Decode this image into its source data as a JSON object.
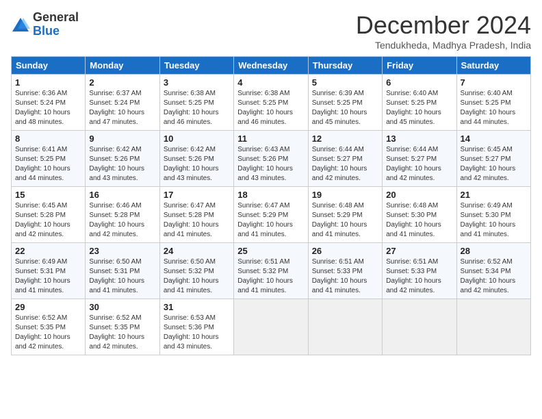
{
  "header": {
    "logo_general": "General",
    "logo_blue": "Blue",
    "title": "December 2024",
    "location": "Tendukheda, Madhya Pradesh, India"
  },
  "weekdays": [
    "Sunday",
    "Monday",
    "Tuesday",
    "Wednesday",
    "Thursday",
    "Friday",
    "Saturday"
  ],
  "weeks": [
    [
      {
        "day": "1",
        "info": "Sunrise: 6:36 AM\nSunset: 5:24 PM\nDaylight: 10 hours\nand 48 minutes."
      },
      {
        "day": "2",
        "info": "Sunrise: 6:37 AM\nSunset: 5:24 PM\nDaylight: 10 hours\nand 47 minutes."
      },
      {
        "day": "3",
        "info": "Sunrise: 6:38 AM\nSunset: 5:25 PM\nDaylight: 10 hours\nand 46 minutes."
      },
      {
        "day": "4",
        "info": "Sunrise: 6:38 AM\nSunset: 5:25 PM\nDaylight: 10 hours\nand 46 minutes."
      },
      {
        "day": "5",
        "info": "Sunrise: 6:39 AM\nSunset: 5:25 PM\nDaylight: 10 hours\nand 45 minutes."
      },
      {
        "day": "6",
        "info": "Sunrise: 6:40 AM\nSunset: 5:25 PM\nDaylight: 10 hours\nand 45 minutes."
      },
      {
        "day": "7",
        "info": "Sunrise: 6:40 AM\nSunset: 5:25 PM\nDaylight: 10 hours\nand 44 minutes."
      }
    ],
    [
      {
        "day": "8",
        "info": "Sunrise: 6:41 AM\nSunset: 5:25 PM\nDaylight: 10 hours\nand 44 minutes."
      },
      {
        "day": "9",
        "info": "Sunrise: 6:42 AM\nSunset: 5:26 PM\nDaylight: 10 hours\nand 43 minutes."
      },
      {
        "day": "10",
        "info": "Sunrise: 6:42 AM\nSunset: 5:26 PM\nDaylight: 10 hours\nand 43 minutes."
      },
      {
        "day": "11",
        "info": "Sunrise: 6:43 AM\nSunset: 5:26 PM\nDaylight: 10 hours\nand 43 minutes."
      },
      {
        "day": "12",
        "info": "Sunrise: 6:44 AM\nSunset: 5:27 PM\nDaylight: 10 hours\nand 42 minutes."
      },
      {
        "day": "13",
        "info": "Sunrise: 6:44 AM\nSunset: 5:27 PM\nDaylight: 10 hours\nand 42 minutes."
      },
      {
        "day": "14",
        "info": "Sunrise: 6:45 AM\nSunset: 5:27 PM\nDaylight: 10 hours\nand 42 minutes."
      }
    ],
    [
      {
        "day": "15",
        "info": "Sunrise: 6:45 AM\nSunset: 5:28 PM\nDaylight: 10 hours\nand 42 minutes."
      },
      {
        "day": "16",
        "info": "Sunrise: 6:46 AM\nSunset: 5:28 PM\nDaylight: 10 hours\nand 42 minutes."
      },
      {
        "day": "17",
        "info": "Sunrise: 6:47 AM\nSunset: 5:28 PM\nDaylight: 10 hours\nand 41 minutes."
      },
      {
        "day": "18",
        "info": "Sunrise: 6:47 AM\nSunset: 5:29 PM\nDaylight: 10 hours\nand 41 minutes."
      },
      {
        "day": "19",
        "info": "Sunrise: 6:48 AM\nSunset: 5:29 PM\nDaylight: 10 hours\nand 41 minutes."
      },
      {
        "day": "20",
        "info": "Sunrise: 6:48 AM\nSunset: 5:30 PM\nDaylight: 10 hours\nand 41 minutes."
      },
      {
        "day": "21",
        "info": "Sunrise: 6:49 AM\nSunset: 5:30 PM\nDaylight: 10 hours\nand 41 minutes."
      }
    ],
    [
      {
        "day": "22",
        "info": "Sunrise: 6:49 AM\nSunset: 5:31 PM\nDaylight: 10 hours\nand 41 minutes."
      },
      {
        "day": "23",
        "info": "Sunrise: 6:50 AM\nSunset: 5:31 PM\nDaylight: 10 hours\nand 41 minutes."
      },
      {
        "day": "24",
        "info": "Sunrise: 6:50 AM\nSunset: 5:32 PM\nDaylight: 10 hours\nand 41 minutes."
      },
      {
        "day": "25",
        "info": "Sunrise: 6:51 AM\nSunset: 5:32 PM\nDaylight: 10 hours\nand 41 minutes."
      },
      {
        "day": "26",
        "info": "Sunrise: 6:51 AM\nSunset: 5:33 PM\nDaylight: 10 hours\nand 41 minutes."
      },
      {
        "day": "27",
        "info": "Sunrise: 6:51 AM\nSunset: 5:33 PM\nDaylight: 10 hours\nand 42 minutes."
      },
      {
        "day": "28",
        "info": "Sunrise: 6:52 AM\nSunset: 5:34 PM\nDaylight: 10 hours\nand 42 minutes."
      }
    ],
    [
      {
        "day": "29",
        "info": "Sunrise: 6:52 AM\nSunset: 5:35 PM\nDaylight: 10 hours\nand 42 minutes."
      },
      {
        "day": "30",
        "info": "Sunrise: 6:52 AM\nSunset: 5:35 PM\nDaylight: 10 hours\nand 42 minutes."
      },
      {
        "day": "31",
        "info": "Sunrise: 6:53 AM\nSunset: 5:36 PM\nDaylight: 10 hours\nand 43 minutes."
      },
      {
        "day": "",
        "info": ""
      },
      {
        "day": "",
        "info": ""
      },
      {
        "day": "",
        "info": ""
      },
      {
        "day": "",
        "info": ""
      }
    ]
  ]
}
